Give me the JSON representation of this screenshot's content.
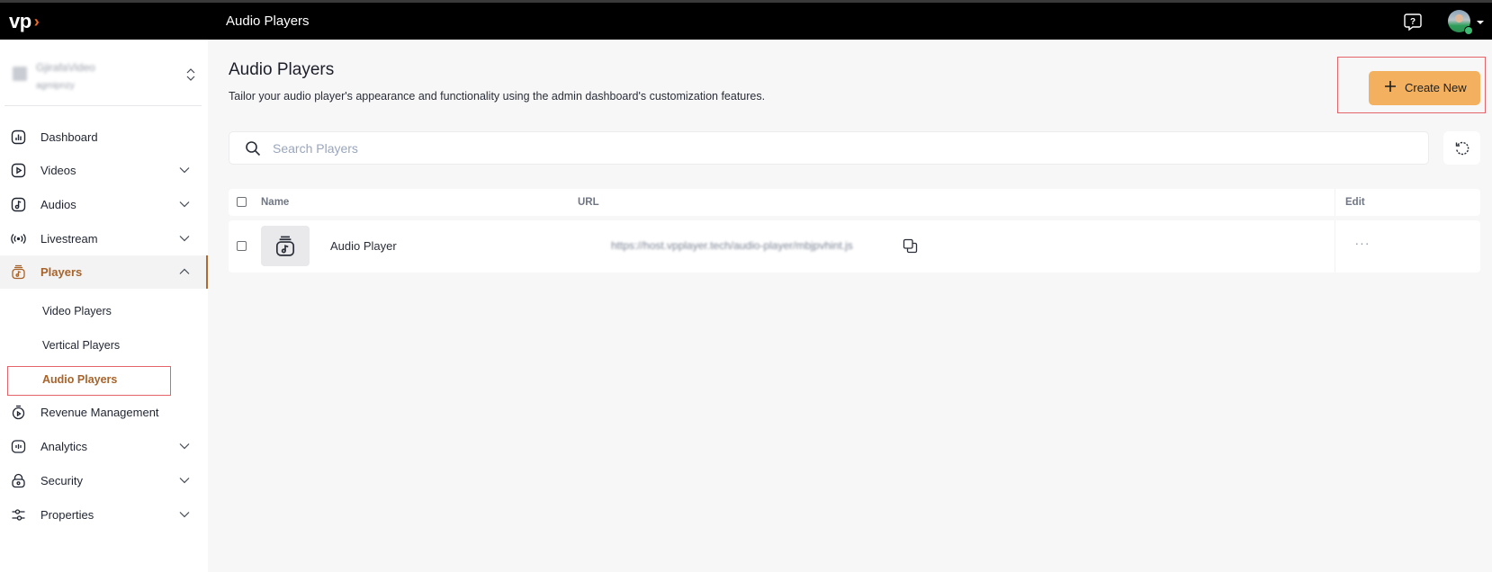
{
  "topbar": {
    "logo_text": "vp",
    "logo_mark": "›",
    "title": "Audio Players",
    "help_icon": "help-chat-icon",
    "avatar_icon": "user-avatar"
  },
  "sidebar": {
    "org": {
      "name": "GjirafaVideo",
      "id": "agmipnzy"
    },
    "items": [
      {
        "label": "Dashboard",
        "icon": "dashboard-chart-icon",
        "expandable": false
      },
      {
        "label": "Videos",
        "icon": "video-play-icon",
        "expandable": true
      },
      {
        "label": "Audios",
        "icon": "music-note-icon",
        "expandable": true
      },
      {
        "label": "Livestream",
        "icon": "broadcast-icon",
        "expandable": true
      },
      {
        "label": "Players",
        "icon": "player-jar-icon",
        "expandable": true,
        "expanded": true,
        "active": true
      },
      {
        "label": "Revenue Management",
        "icon": "stopwatch-icon",
        "expandable": false
      },
      {
        "label": "Analytics",
        "icon": "analytics-icon",
        "expandable": true
      },
      {
        "label": "Security",
        "icon": "lock-icon",
        "expandable": true
      },
      {
        "label": "Properties",
        "icon": "sliders-icon",
        "expandable": true
      }
    ],
    "players_sub": [
      {
        "label": "Video Players"
      },
      {
        "label": "Vertical Players"
      },
      {
        "label": "Audio Players",
        "active": true
      }
    ]
  },
  "main": {
    "title": "Audio Players",
    "description": "Tailor your audio player's appearance and functionality using the admin dashboard's customization features.",
    "create_button": "Create New",
    "search": {
      "placeholder": "Search Players",
      "value": ""
    },
    "table": {
      "columns": [
        "Name",
        "URL",
        "Edit"
      ],
      "rows": [
        {
          "name": "Audio Player",
          "url": "https://host.vpplayer.tech/audio-player/mbjpvhint.js",
          "checked": false
        }
      ]
    }
  },
  "colors": {
    "accent": "#f3b15f",
    "active_nav": "#a8632a",
    "highlight_box": "#e5646a",
    "topbar": "#000000"
  }
}
